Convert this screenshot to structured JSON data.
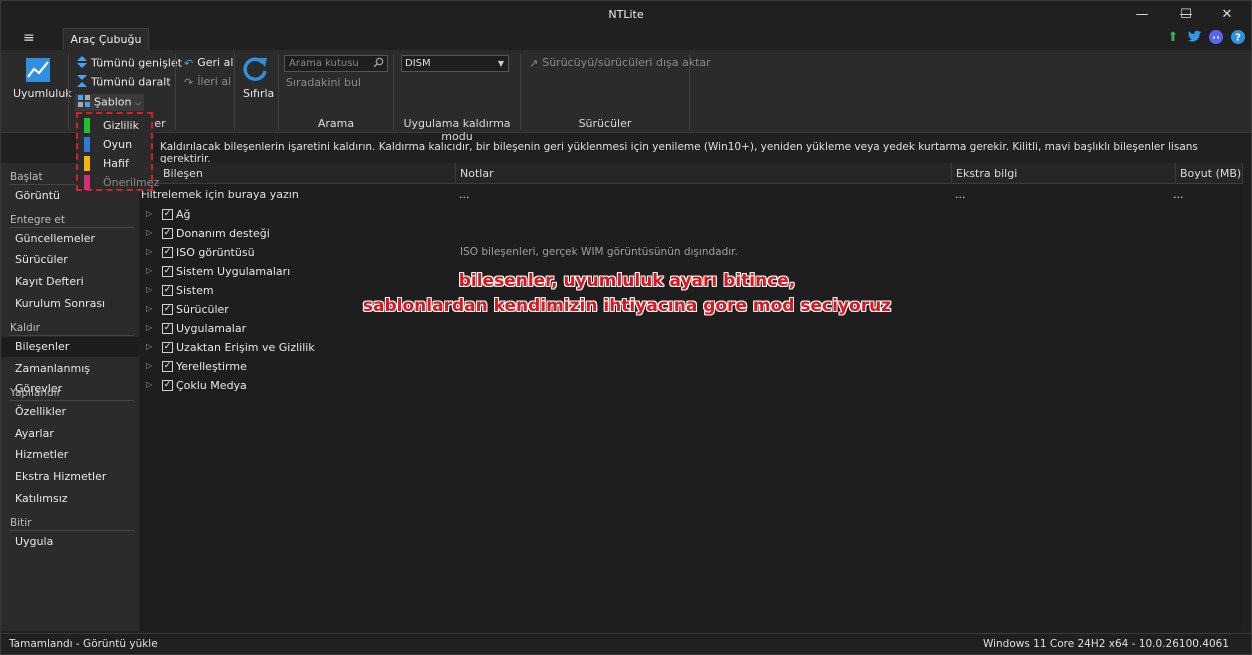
{
  "window": {
    "title": "NTLite"
  },
  "titlebar": {
    "minimize": "—",
    "maximize": "☐",
    "close": "✕"
  },
  "ribbon_tab": {
    "label": "Araç Çubuğu"
  },
  "ribbon": {
    "uyumluluk": "Uyumluluk",
    "expand_all": "Tümünü genişlet",
    "collapse_all": "Tümünü daralt",
    "sablon": "Şablon",
    "sablon_group_partial": "er",
    "undo": "Geri al",
    "redo": "İleri al",
    "reset": "Sıfırla",
    "search_placeholder": "Arama kutusu",
    "find_next": "Sıradakini bul",
    "search_group": "Arama",
    "mode_value": "DISM",
    "mode_group": "Uygulama kaldırma modu",
    "export_drivers": "Sürücüyü/sürücüleri dışa aktar",
    "drivers_group": "Sürücüler"
  },
  "dropdown": {
    "items": [
      {
        "label": "Gizlilik",
        "color": "#22c02a"
      },
      {
        "label": "Oyun",
        "color": "#2f7ad9"
      },
      {
        "label": "Hafif",
        "color": "#f2b705"
      },
      {
        "label": "Önerilmez",
        "color": "#d0307a"
      }
    ]
  },
  "info_text": "Kaldırılacak bileşenlerin işaretini kaldırın. Kaldırma kalıcıdır, bir bileşenin geri yüklenmesi için yenileme (Win10+), yeniden yükleme veya yedek kurtarma gerekir. Kilitli, mavi başlıklı bileşenler lisans gerektirir.",
  "sidebar": {
    "sections": [
      {
        "header": "Başlat",
        "items": [
          "Görüntü"
        ]
      },
      {
        "header": "Entegre et",
        "items": [
          "Güncellemeler",
          "Sürücüler",
          "Kayıt Defteri",
          "Kurulum Sonrası"
        ]
      },
      {
        "header": "Kaldır",
        "items": [
          "Bileşenler",
          "Zamanlanmış Görevler"
        ]
      },
      {
        "header": "Yapılandır",
        "items": [
          "Özellikler",
          "Ayarlar",
          "Hizmetler",
          "Ekstra Hizmetler",
          "Katılımsız"
        ]
      },
      {
        "header": "Bitir",
        "items": [
          "Uygula"
        ]
      }
    ]
  },
  "table": {
    "columns": [
      "Bileşen",
      "Notlar",
      "Ekstra bilgi",
      "Boyut (MB)"
    ],
    "filter_placeholder": "Filtrelemek için buraya yazın",
    "filter_ellipsis": "...",
    "rows": [
      {
        "label": "Ağ",
        "note": ""
      },
      {
        "label": "Donanım desteği",
        "note": ""
      },
      {
        "label": "ISO görüntüsü",
        "note": "ISO bileşenleri, gerçek WIM görüntüsünün dışındadır."
      },
      {
        "label": "Sistem Uygulamaları",
        "note": ""
      },
      {
        "label": "Sistem",
        "note": ""
      },
      {
        "label": "Sürücüler",
        "note": ""
      },
      {
        "label": "Uygulamalar",
        "note": ""
      },
      {
        "label": "Uzaktan Erişim ve Gizlilik",
        "note": ""
      },
      {
        "label": "Yerelleştirme",
        "note": ""
      },
      {
        "label": "Çoklu Medya",
        "note": ""
      }
    ]
  },
  "overlay": {
    "line1": "bilesenler, uyumluluk ayarı bitince,",
    "line2": "sablonlardan kendimizin ihtiyacına gore mod seciyoruz"
  },
  "status": {
    "left": "Tamamlandı - Görüntü yükle",
    "right": "Windows 11 Core 24H2 x64 - 10.0.26100.4061"
  },
  "colors": {
    "accent_blue": "#2f8fe0",
    "overlay_red": "#e0141b"
  }
}
